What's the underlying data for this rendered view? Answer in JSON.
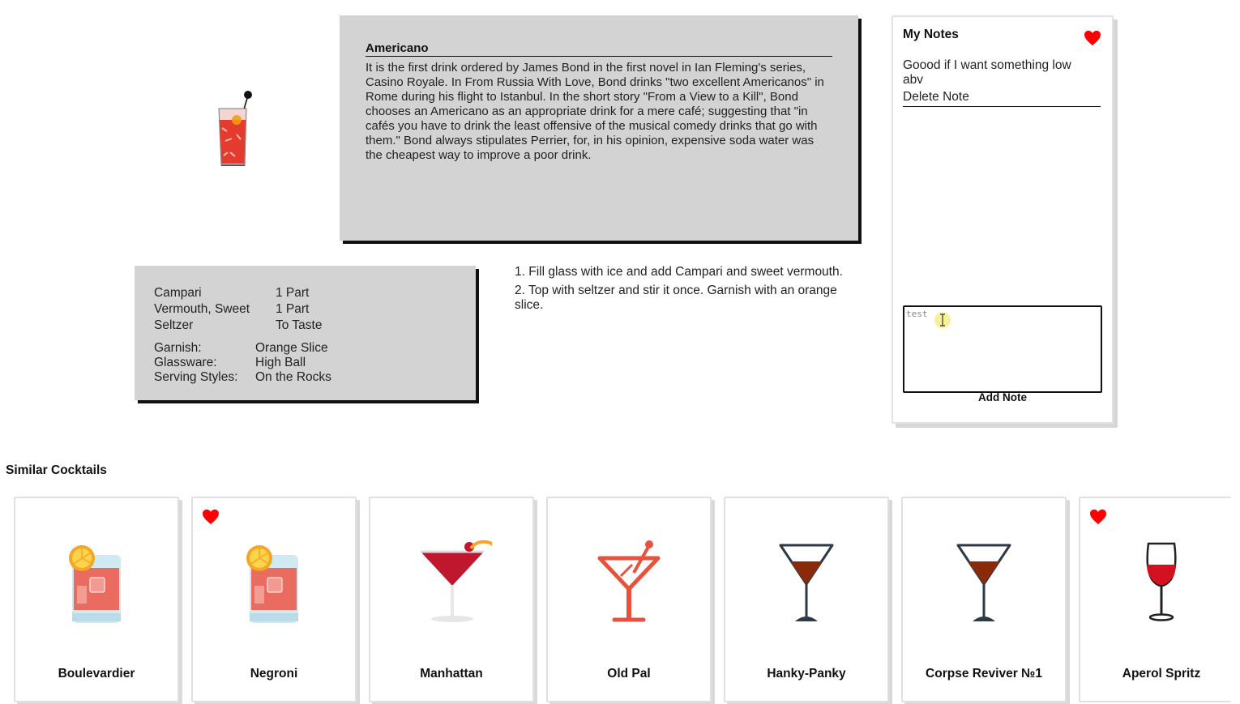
{
  "drink": {
    "name": "Americano",
    "image_icon": "highball-glass-icon",
    "description": "It is the first drink ordered by James Bond in the first novel in Ian Fleming's series, Casino Royale. In From Russia With Love, Bond drinks \"two excellent Americanos\" in Rome during his flight to Istanbul. In the short story \"From a View to a Kill\", Bond chooses an Americano as an appropriate drink for a mere café; suggesting that \"in cafés you have to drink the least offensive of the musical comedy drinks that go with them.\" Bond always stipulates Perrier, for, in his opinion, expensive soda water was the cheapest way to improve a poor drink."
  },
  "ingredients": [
    {
      "name": "Campari",
      "amount": "1 Part"
    },
    {
      "name": "Vermouth, Sweet",
      "amount": "1 Part"
    },
    {
      "name": "Seltzer",
      "amount": "To Taste"
    }
  ],
  "meta": [
    {
      "label": "Garnish:",
      "value": "Orange Slice"
    },
    {
      "label": "Glassware:",
      "value": "High Ball"
    },
    {
      "label": "Serving Styles:",
      "value": "On the Rocks"
    }
  ],
  "steps": [
    "1. Fill glass with ice and add Campari and sweet vermouth.",
    "2. Top with seltzer and stir it once. Garnish with an orange slice."
  ],
  "notes": {
    "title": "My Notes",
    "favorite": true,
    "items": [
      {
        "text": "Goood if I want something low abv",
        "delete_label": "Delete Note"
      }
    ],
    "input_value": "test",
    "add_label": "Add Note"
  },
  "similar": {
    "title": "Similar Cocktails",
    "items": [
      {
        "name": "Boulevardier",
        "favorite": false,
        "icon": "rocks-glass-orange-icon"
      },
      {
        "name": "Negroni",
        "favorite": true,
        "icon": "rocks-glass-orange-icon"
      },
      {
        "name": "Manhattan",
        "favorite": false,
        "icon": "martini-cherry-icon"
      },
      {
        "name": "Old Pal",
        "favorite": false,
        "icon": "cocktail-glass-icon"
      },
      {
        "name": "Hanky-Panky",
        "favorite": false,
        "icon": "martini-glass-icon"
      },
      {
        "name": "Corpse Reviver №1",
        "favorite": false,
        "icon": "martini-glass-icon"
      },
      {
        "name": "Aperol Spritz",
        "favorite": true,
        "icon": "wine-glass-icon"
      }
    ]
  },
  "colors": {
    "panel_gray": "#d3d3d3",
    "heart_red": "#ff0000",
    "campari_red": "#e8453c",
    "brown_liquid": "#8b2a0b"
  }
}
